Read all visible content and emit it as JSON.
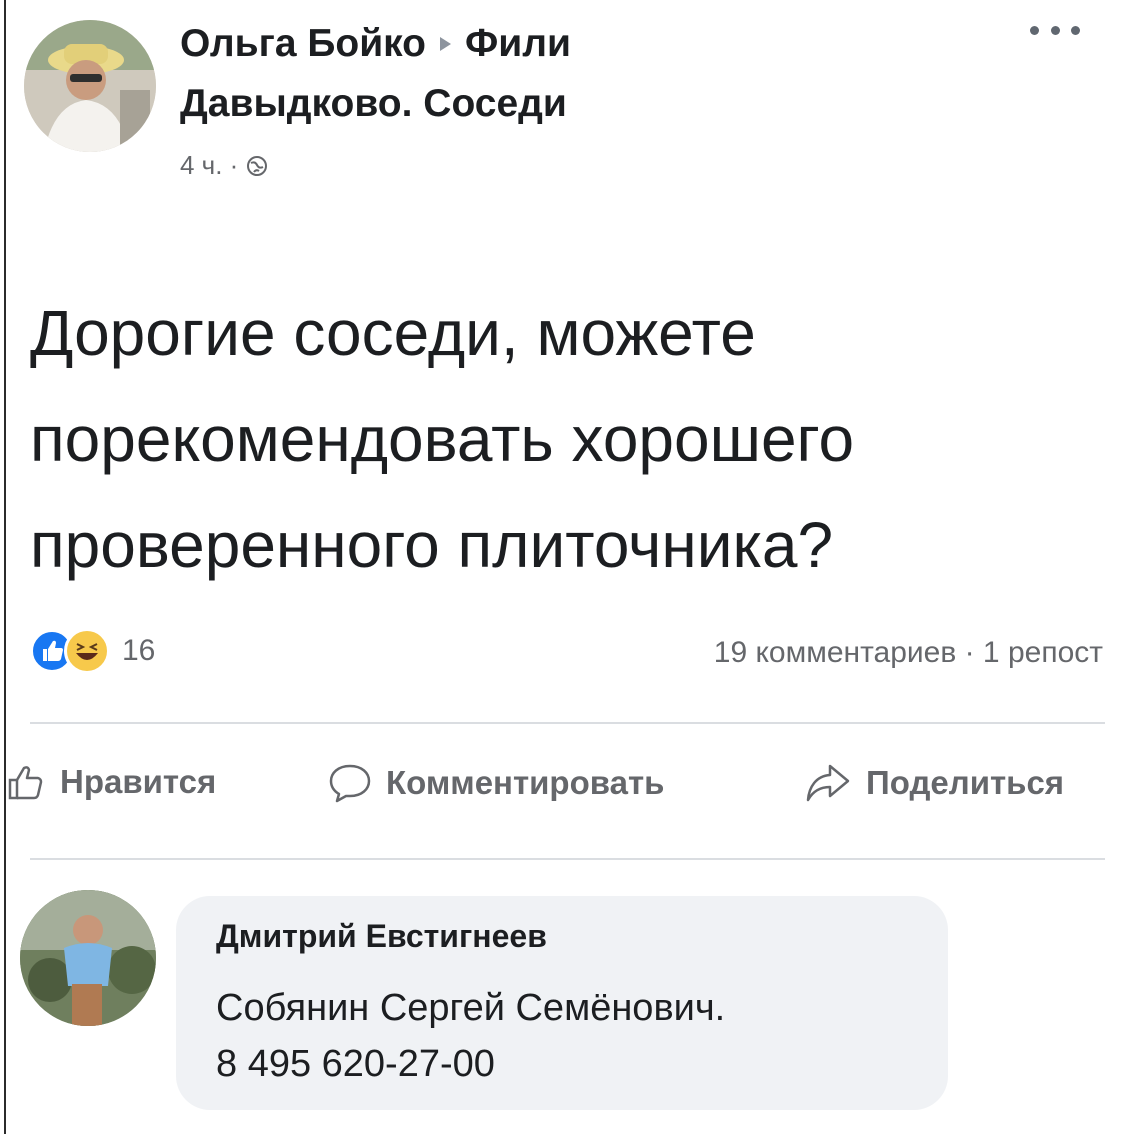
{
  "post": {
    "author": "Ольга Бойко",
    "group_line1": "Фили",
    "group_line2": "Давыдково. Соседи",
    "time": "4 ч. ·",
    "text": "Дорогие соседи, можете порекомендовать хорошего проверенного плиточника?",
    "reaction_count": "16",
    "stats": "19 комментариев · 1 репост",
    "icons": {
      "more": "more-icon",
      "globe": "globe-icon",
      "like_reaction": "like-reaction-icon",
      "haha_reaction": "haha-reaction-icon"
    }
  },
  "actions": {
    "like": "Нравится",
    "comment": "Комментировать",
    "share": "Поделиться"
  },
  "comment": {
    "author": "Дмитрий Евстигнеев",
    "line1": "Собянин Сергей Семёнович.",
    "line2": "8 495 620-27-00"
  },
  "colors": {
    "facebook_blue": "#1877f2",
    "haha_yellow": "#f7c94b",
    "secondary_text": "#65676b",
    "comment_bg": "#f0f2f5"
  }
}
